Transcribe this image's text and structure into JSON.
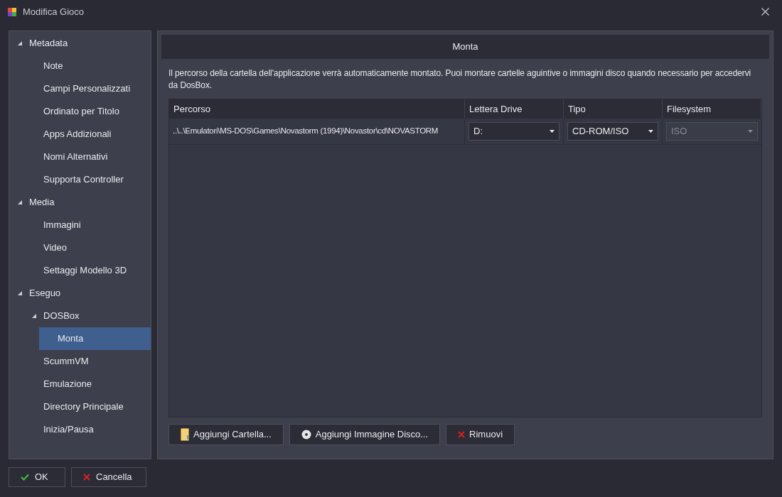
{
  "window": {
    "title": "Modifica Gioco"
  },
  "sidebar": {
    "items": [
      {
        "label": "Metadata",
        "expanded": true,
        "selected": false,
        "children": [
          {
            "label": "Note",
            "selected": false
          },
          {
            "label": "Campi Personalizzati",
            "selected": false
          },
          {
            "label": "Ordinato per Titolo",
            "selected": false
          },
          {
            "label": "Apps Addizionali",
            "selected": false
          },
          {
            "label": "Nomi Alternativi",
            "selected": false
          },
          {
            "label": "Supporta Controller",
            "selected": false
          }
        ]
      },
      {
        "label": "Media",
        "expanded": true,
        "selected": false,
        "children": [
          {
            "label": "Immagini",
            "selected": false
          },
          {
            "label": "Video",
            "selected": false
          },
          {
            "label": "Settaggi Modello 3D",
            "selected": false
          }
        ]
      },
      {
        "label": "Eseguo",
        "expanded": true,
        "selected": false,
        "children": [
          {
            "label": "DOSBox",
            "expanded": true,
            "selected": false,
            "children": [
              {
                "label": "Monta",
                "selected": true
              }
            ]
          },
          {
            "label": "ScummVM",
            "selected": false
          },
          {
            "label": "Emulazione",
            "selected": false
          },
          {
            "label": "Directory Principale",
            "selected": false
          },
          {
            "label": "Inizia/Pausa",
            "selected": false
          }
        ]
      }
    ]
  },
  "panel": {
    "title": "Monta",
    "description": "Il percorso della cartella dell'applicazione verrà automaticamente montato. Puoi montare cartelle aguintive o immagini disco quando necessario per accedervi da DosBox.",
    "table": {
      "columns": [
        "Percorso",
        "Lettera Drive",
        "Tipo",
        "Filesystem"
      ],
      "rows": [
        {
          "path": "..\\..\\Emulatori\\MS-DOS\\Games\\Novastorm (1994)\\Novastor\\cd\\NOVASTORM",
          "drive": {
            "value": "D:",
            "disabled": false
          },
          "type": {
            "value": "CD-ROM/ISO",
            "disabled": false
          },
          "filesystem": {
            "value": "ISO",
            "disabled": true
          }
        }
      ]
    },
    "buttons": [
      {
        "label": "Aggiungi Cartella...",
        "kind": "folder"
      },
      {
        "label": "Aggiungi Immagine Disco...",
        "kind": "disc"
      },
      {
        "label": "Rimuovi",
        "kind": "remove"
      }
    ]
  },
  "footer": {
    "buttons": [
      {
        "label": "OK",
        "kind": "ok"
      },
      {
        "label": "Cancella",
        "kind": "cancel"
      }
    ]
  }
}
